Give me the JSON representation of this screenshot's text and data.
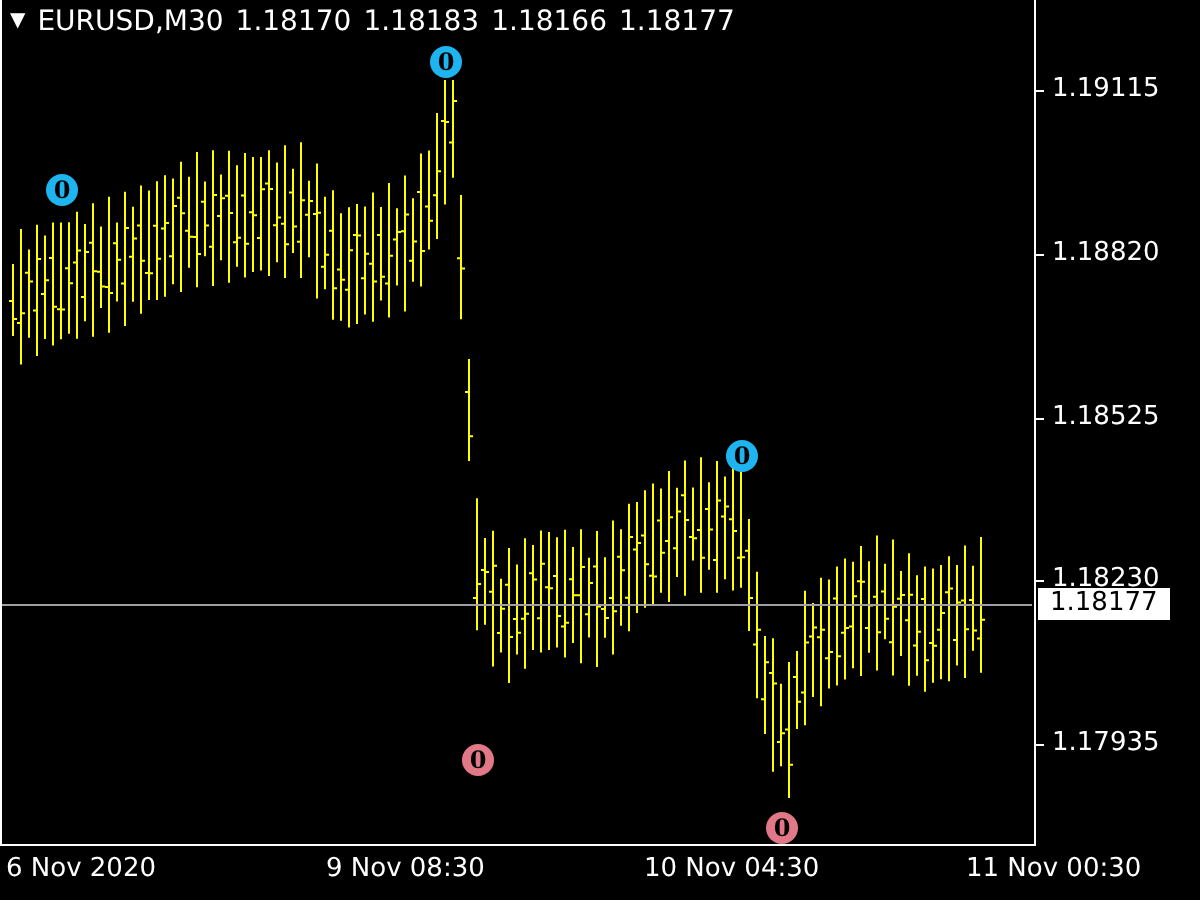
{
  "symbol": {
    "menu_glyph": "▼",
    "name": "EURUSD,M30",
    "ohlc": [
      "1.18170",
      "1.18183",
      "1.18166",
      "1.18177"
    ]
  },
  "price_axis": {
    "ticks": [
      "1.19115",
      "1.18820",
      "1.18525",
      "1.18230",
      "1.17935"
    ],
    "current_price": "1.18177"
  },
  "time_axis": {
    "labels": [
      "6 Nov 2020",
      "9 Nov 08:30",
      "10 Nov 04:30",
      "11 Nov 00:30"
    ]
  },
  "markers": [
    {
      "label": "0",
      "color": "#1eb4f0"
    },
    {
      "label": "0",
      "color": "#1eb4f0"
    },
    {
      "label": "0",
      "color": "#1eb4f0"
    },
    {
      "label": "0",
      "color": "#e07888"
    },
    {
      "label": "0",
      "color": "#e07888"
    }
  ]
}
